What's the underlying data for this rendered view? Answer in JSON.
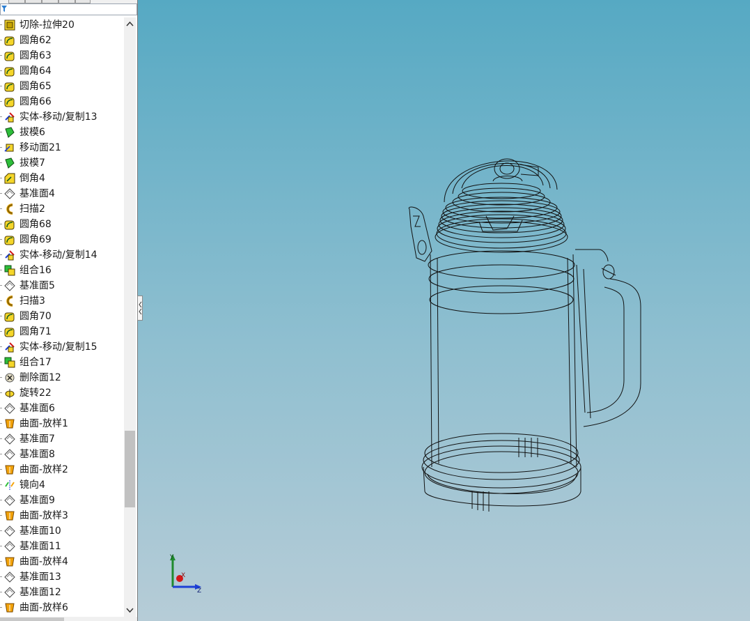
{
  "feature_tree": {
    "items": [
      {
        "label": "切除-拉伸20",
        "icon": "cut-extrude-icon"
      },
      {
        "label": "圆角62",
        "icon": "fillet-icon"
      },
      {
        "label": "圆角63",
        "icon": "fillet-icon"
      },
      {
        "label": "圆角64",
        "icon": "fillet-icon"
      },
      {
        "label": "圆角65",
        "icon": "fillet-icon"
      },
      {
        "label": "圆角66",
        "icon": "fillet-icon"
      },
      {
        "label": "实体-移动/复制13",
        "icon": "move-copy-body-icon"
      },
      {
        "label": "拔模6",
        "icon": "draft-icon"
      },
      {
        "label": "移动面21",
        "icon": "move-face-icon"
      },
      {
        "label": "拔模7",
        "icon": "draft-icon"
      },
      {
        "label": "倒角4",
        "icon": "chamfer-icon"
      },
      {
        "label": "基准面4",
        "icon": "plane-icon"
      },
      {
        "label": "扫描2",
        "icon": "sweep-icon"
      },
      {
        "label": "圆角68",
        "icon": "fillet-icon"
      },
      {
        "label": "圆角69",
        "icon": "fillet-icon"
      },
      {
        "label": "实体-移动/复制14",
        "icon": "move-copy-body-icon"
      },
      {
        "label": "组合16",
        "icon": "combine-icon"
      },
      {
        "label": "基准面5",
        "icon": "plane-icon"
      },
      {
        "label": "扫描3",
        "icon": "sweep-icon"
      },
      {
        "label": "圆角70",
        "icon": "fillet-icon"
      },
      {
        "label": "圆角71",
        "icon": "fillet-icon"
      },
      {
        "label": "实体-移动/复制15",
        "icon": "move-copy-body-icon"
      },
      {
        "label": "组合17",
        "icon": "combine-icon"
      },
      {
        "label": "删除面12",
        "icon": "delete-face-icon"
      },
      {
        "label": "旋转22",
        "icon": "revolve-icon"
      },
      {
        "label": "基准面6",
        "icon": "plane-icon"
      },
      {
        "label": "曲面-放样1",
        "icon": "surface-loft-icon"
      },
      {
        "label": "基准面7",
        "icon": "plane-icon"
      },
      {
        "label": "基准面8",
        "icon": "plane-icon"
      },
      {
        "label": "曲面-放样2",
        "icon": "surface-loft-icon"
      },
      {
        "label": "镜向4",
        "icon": "mirror-icon"
      },
      {
        "label": "基准面9",
        "icon": "plane-icon"
      },
      {
        "label": "曲面-放样3",
        "icon": "surface-loft-icon"
      },
      {
        "label": "基准面10",
        "icon": "plane-icon"
      },
      {
        "label": "基准面11",
        "icon": "plane-icon"
      },
      {
        "label": "曲面-放样4",
        "icon": "surface-loft-icon"
      },
      {
        "label": "基准面13",
        "icon": "plane-icon"
      },
      {
        "label": "基准面12",
        "icon": "plane-icon"
      },
      {
        "label": "曲面-放样6",
        "icon": "surface-loft-icon"
      }
    ]
  },
  "triad": {
    "x_label": "X",
    "y_label": "Y",
    "z_label": "Z"
  },
  "colors": {
    "viewport_top": "#56a9c3",
    "viewport_bottom": "#b6ccd7",
    "accent": "#2e7fd1"
  }
}
